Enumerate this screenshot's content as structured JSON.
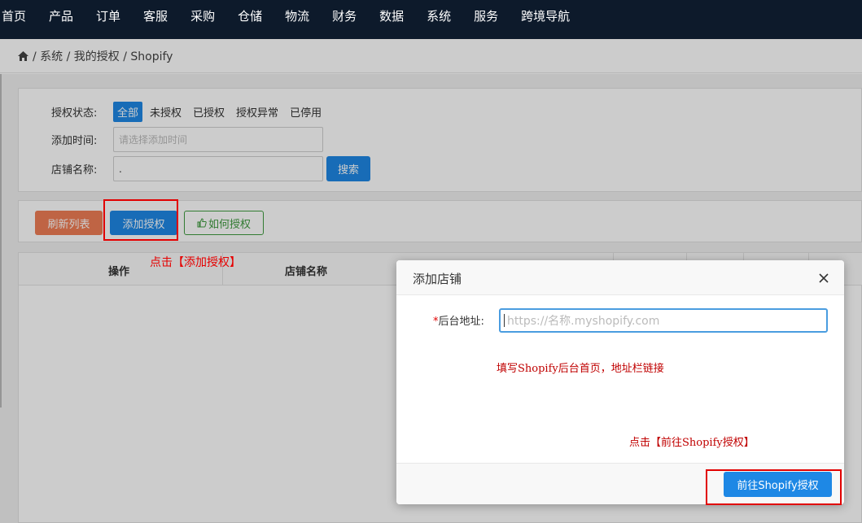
{
  "nav": {
    "items": [
      "首页",
      "产品",
      "订单",
      "客服",
      "采购",
      "仓储",
      "物流",
      "财务",
      "数据",
      "系统",
      "服务",
      "跨境导航"
    ]
  },
  "breadcrumb": {
    "text": "/ 系统 / 我的授权 / Shopify"
  },
  "filters": {
    "status_label": "授权状态:",
    "status_options": [
      "全部",
      "未授权",
      "已授权",
      "授权异常",
      "已停用"
    ],
    "date_label": "添加时间:",
    "date_placeholder": "请选择添加时间",
    "shop_label": "店铺名称:",
    "shop_value": ".",
    "search_label": "搜索"
  },
  "actions": {
    "refresh_label": "刷新列表",
    "add_label": "添加授权",
    "how_label": "如何授权"
  },
  "annotations": {
    "click_add": "点击【添加授权】",
    "fill_hint": "填写Shopify后台首页，地址栏链接",
    "click_goto": "点击【前往Shopify授权】"
  },
  "table": {
    "headers": [
      "操作",
      "店铺名称"
    ]
  },
  "modal": {
    "title": "添加店铺",
    "required_mark": "*",
    "field_label": "后台地址:",
    "url_placeholder": "https://名称.myshopify.com",
    "submit_label": "前往Shopify授权"
  },
  "colors": {
    "nav_bg": "#0d1a2b",
    "primary": "#1e88e5",
    "refresh": "#ef7d55",
    "how_green": "#3f9b3f",
    "annotation_red": "#e10000"
  }
}
